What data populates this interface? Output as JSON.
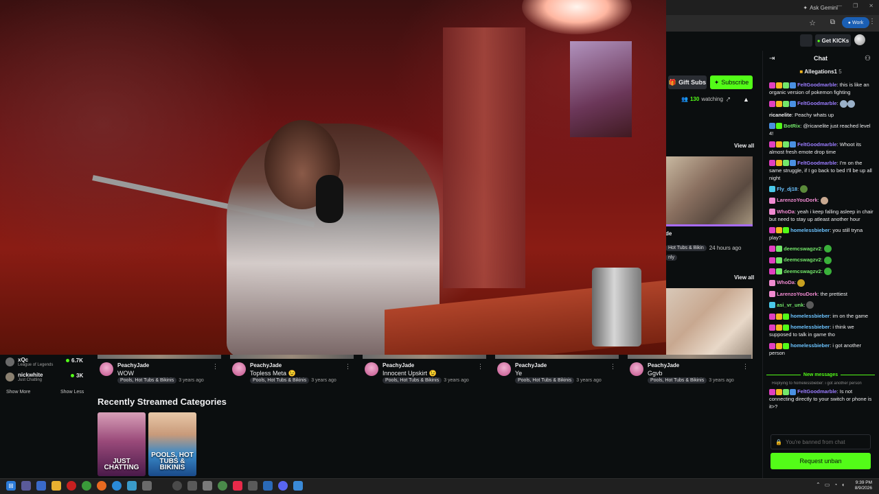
{
  "browser": {
    "ask_gemini": "Ask Gemini",
    "profile_label": "Work"
  },
  "site_header": {
    "get_kicks_label": "Get KICKs"
  },
  "channel_actions": {
    "gift_subs_label": "Gift Subs",
    "subscribe_label": "Subscribe",
    "watching_count": "130",
    "watching_suffix": "watching"
  },
  "related": {
    "view_all_1": "View all",
    "view_all_2": "View all",
    "card_title_fragment": "de",
    "card_tag": "Hot Tubs & Bikin",
    "card_age": "24 hours ago",
    "card_tag2": "nly"
  },
  "left_nav": {
    "channels": [
      {
        "name": "xQc",
        "category": "League of Legends",
        "viewers": "6.7K"
      },
      {
        "name": "nickwhite",
        "category": "Just Chatting",
        "viewers": "3K"
      }
    ],
    "show_more": "Show More",
    "show_less": "Show Less"
  },
  "videos": [
    {
      "channel": "PeachyJade",
      "title": "WOW",
      "category": "Pools, Hot Tubs & Bikinis",
      "age": "3 years ago"
    },
    {
      "channel": "PeachyJade",
      "title": "Topless Meta 😉",
      "category": "Pools, Hot Tubs & Bikinis",
      "age": "3 years ago"
    },
    {
      "channel": "PeachyJade",
      "title": "Innocent Upskirt 😉",
      "category": "Pools, Hot Tubs & Bikinis",
      "age": "3 years ago"
    },
    {
      "channel": "PeachyJade",
      "title": "Ye",
      "category": "Pools, Hot Tubs & Bikinis",
      "age": "3 years ago"
    },
    {
      "channel": "PeachyJade",
      "title": "Ggvb",
      "category": "Pools, Hot Tubs & Bikinis",
      "age": "3 years ago"
    }
  ],
  "recent_categories": {
    "title": "Recently Streamed Categories",
    "items": [
      {
        "label": "JUST CHATTING"
      },
      {
        "label": "POOLS, HOT TUBS & BIKINIS"
      }
    ]
  },
  "chat": {
    "title": "Chat",
    "pinned_user": "Allegations1",
    "pinned_count": "5",
    "messages": [
      {
        "user": "FeltGoodmarble",
        "text": "this is like an organic version of pokemon fighting",
        "color": "purple"
      },
      {
        "user": "FeltGoodmarble",
        "text": "",
        "color": "purple"
      },
      {
        "user": "ricanelite",
        "text": "Peachy whats up",
        "color": "white"
      },
      {
        "user": "BotRix",
        "text": "@ricanelite just reached level 4!",
        "color": "green"
      },
      {
        "user": "FeltGoodmarble",
        "text": "Whoot its almost fresh emote drop time",
        "color": "purple"
      },
      {
        "user": "FeltGoodmarble",
        "text": "I'm on the same struggle, if I go back to bed I'll be up all night",
        "color": "purple"
      },
      {
        "user": "Fly_dj18",
        "text": "",
        "color": "blue"
      },
      {
        "user": "LarenzoYouDork",
        "text": "",
        "color": "pink"
      },
      {
        "user": "WhoDa",
        "text": "yeah i keep falling asleep in chair but need to stay up atleast another hour",
        "color": "pink"
      },
      {
        "user": "homelessbieber",
        "text": "you still tryna play?",
        "color": "blue"
      },
      {
        "user": "deemcswagzv2",
        "text": "",
        "color": "green"
      },
      {
        "user": "deemcswagzv2",
        "text": "",
        "color": "green"
      },
      {
        "user": "deemcswagzv2",
        "text": "",
        "color": "green"
      },
      {
        "user": "WhoDa",
        "text": "",
        "color": "pink"
      },
      {
        "user": "LarenzoYouDork",
        "text": "the prettiest",
        "color": "pink"
      },
      {
        "user": "asi_vr_unk",
        "text": "",
        "color": "green"
      },
      {
        "user": "homelessbieber",
        "text": "im on the game",
        "color": "blue"
      },
      {
        "user": "homelessbieber",
        "text": "i think we supposed to talk in game tho",
        "color": "blue"
      },
      {
        "user": "homelessbieber",
        "text": "i got another person",
        "color": "blue"
      }
    ],
    "new_messages_label": "New messages",
    "reply_context": "Replying to homelessbieber: i got another person",
    "last_message": {
      "user": "FeltGoodmarble",
      "text": "Is not connecting directly to your switch or phone is it>?"
    },
    "banned_placeholder": "You're banned from chat",
    "request_unban_label": "Request unban"
  },
  "taskbar": {
    "time": "9:39 PM",
    "date": "8/9/2026"
  },
  "colors": {
    "accent": "#53fc18",
    "background": "#0b0e0f"
  }
}
